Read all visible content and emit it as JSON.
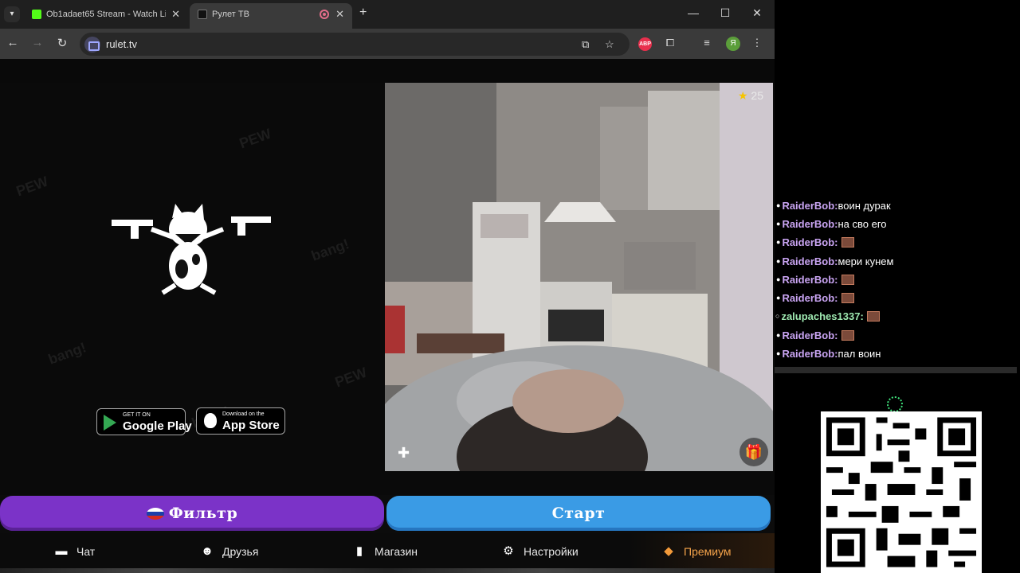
{
  "browser": {
    "tabs": [
      {
        "title": "Ob1adaet65 Stream - Watch Li",
        "favicon": "kick-icon"
      },
      {
        "title": "Рулет ТВ",
        "favicon": "rulet-icon",
        "recording": true
      }
    ],
    "url": "rulet.tv",
    "profile_initial": "Я",
    "abp_label": "ABP"
  },
  "app": {
    "stores": [
      {
        "small": "GET IT ON",
        "big": "Google Play"
      },
      {
        "small": "Download on the",
        "big": "App Store"
      }
    ],
    "doodle_text": "PEW",
    "doodle_text2": "bang!",
    "stars_count": "25",
    "filter_label": "Фильтр",
    "start_label": "Старт",
    "nav": [
      {
        "label": "Чат",
        "icon": "chat-icon"
      },
      {
        "label": "Друзья",
        "icon": "friends-icon"
      },
      {
        "label": "Магазин",
        "icon": "shop-icon"
      },
      {
        "label": "Настройки",
        "icon": "gear-icon"
      },
      {
        "label": "Премиум",
        "icon": "premium-tag-icon"
      }
    ],
    "colors": {
      "filter": "#7b33c8",
      "start": "#3a9be5",
      "premium": "#f3a24a"
    }
  },
  "chat": {
    "messages": [
      {
        "user": "RaiderBob:",
        "text": "воин дурак"
      },
      {
        "user": "RaiderBob:",
        "text": "на сво его"
      },
      {
        "user": "RaiderBob:",
        "text": "",
        "emote": true
      },
      {
        "user": "RaiderBob:",
        "text": "мери кунем"
      },
      {
        "user": "RaiderBob:",
        "text": "",
        "emote": true
      },
      {
        "user": "RaiderBob:",
        "text": "",
        "emote": true
      },
      {
        "user": "zalupaches1337:",
        "text": "",
        "emote": true
      },
      {
        "user": "RaiderBob:",
        "text": "",
        "emote": true
      },
      {
        "user": "RaiderBob:",
        "text": "пал воин"
      }
    ]
  }
}
